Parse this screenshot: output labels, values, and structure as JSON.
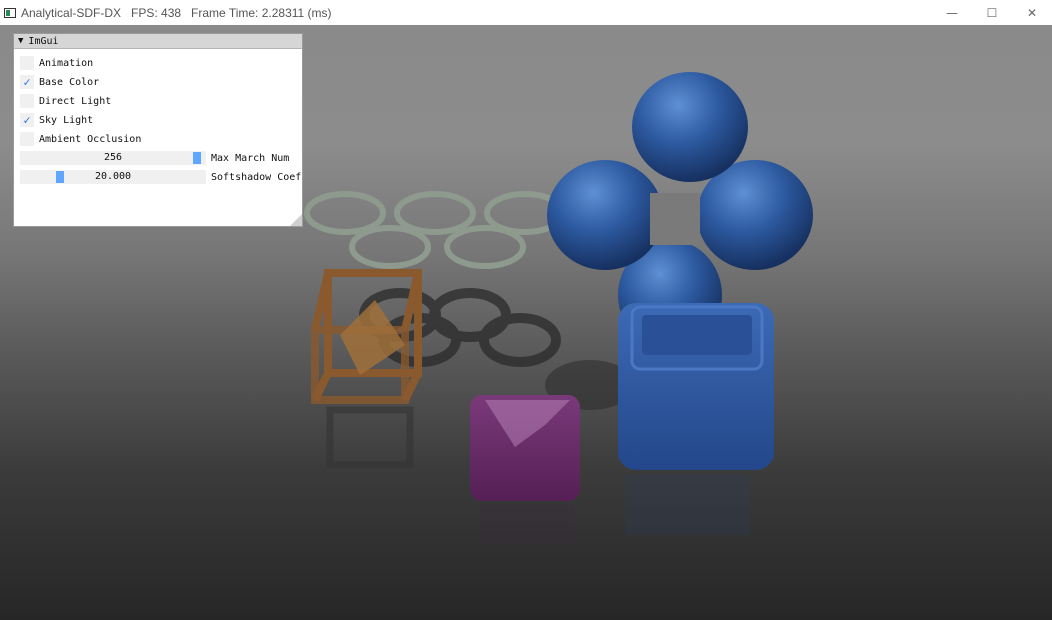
{
  "window": {
    "title": "Analytical-SDF-DX   FPS: 438   Frame Time: 2.28311 (ms)",
    "controls": {
      "minimize": "—",
      "maximize": "☐",
      "close": "✕"
    }
  },
  "imgui": {
    "title": "ImGui",
    "checkboxes": [
      {
        "label": "Animation",
        "checked": false
      },
      {
        "label": "Base Color",
        "checked": true
      },
      {
        "label": "Direct Light",
        "checked": false
      },
      {
        "label": "Sky Light",
        "checked": true
      },
      {
        "label": "Ambient Occlusion",
        "checked": false
      }
    ],
    "sliders": [
      {
        "label": "Max March Num",
        "value": "256",
        "fraction": 0.97
      },
      {
        "label": "Softshadow Coef",
        "value": "20.000",
        "fraction": 0.2
      }
    ],
    "check_mark": "✓"
  },
  "scene": {
    "colors": {
      "torus": "#8e9a8e",
      "frame_cube": "#8a5a2e",
      "purple_box": "#6a2a6a",
      "blue_shapes": "#2d5aa0"
    }
  }
}
